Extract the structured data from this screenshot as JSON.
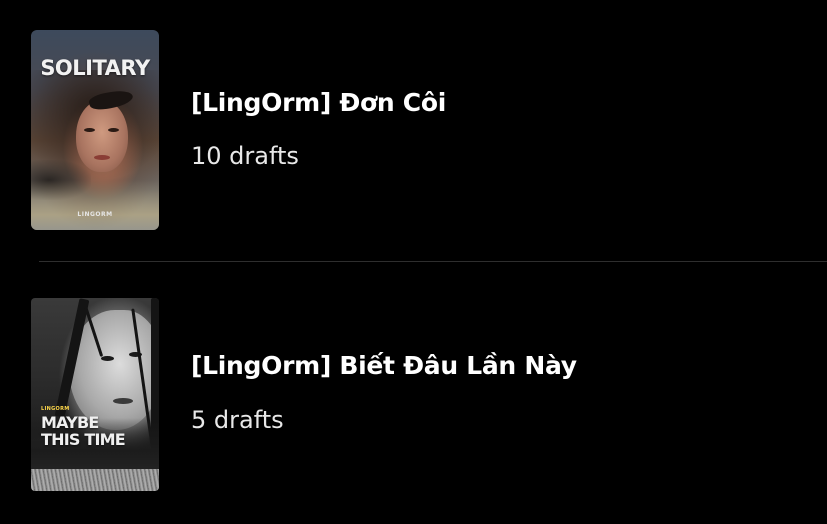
{
  "theme": {
    "background": "#000000",
    "text": "#ffffff",
    "divider": "#2e2e2e"
  },
  "stories": [
    {
      "title": "[LingOrm] Đơn Côi",
      "drafts": "10 drafts",
      "cover": {
        "title": "SOLITARY",
        "label": "LINGORM"
      }
    },
    {
      "title": "[LingOrm] Biết Đâu Lần Này",
      "drafts": "5 drafts",
      "cover": {
        "title_line1": "MAYBE",
        "title_line2": "THIS TIME",
        "label": "LINGORM"
      }
    }
  ]
}
